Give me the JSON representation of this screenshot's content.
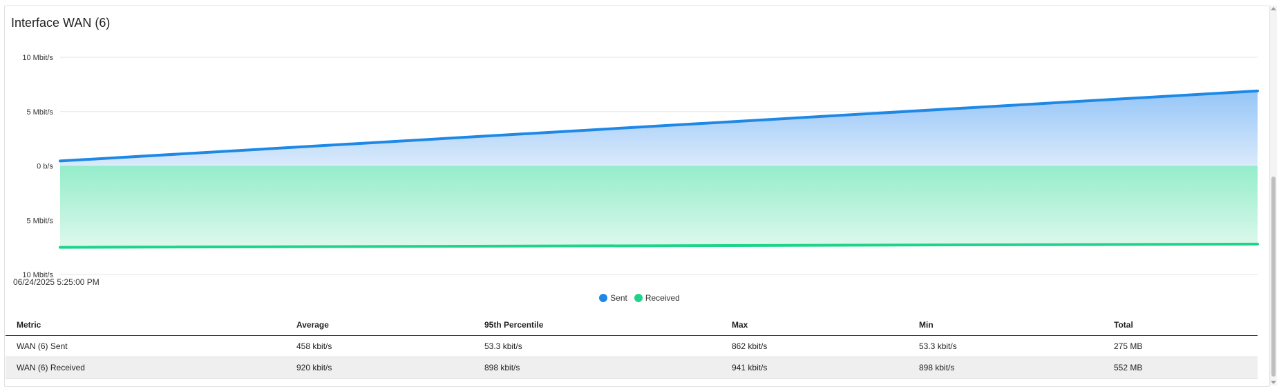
{
  "panel": {
    "title": "Interface WAN (6)",
    "timestamp": "06/24/2025 5:25:00 PM"
  },
  "chart_data": {
    "type": "area",
    "title": "Interface WAN (6)",
    "y_tick_labels": [
      "10 Mbit/s",
      "5 Mbit/s",
      "0 b/s",
      "5 Mbit/s",
      "10 Mbit/s"
    ],
    "y_tick_values": [
      10,
      5,
      0,
      -5,
      -10
    ],
    "ylim": [
      -10,
      10
    ],
    "y_unit": "Mbit/s",
    "grid": true,
    "legend_position": "bottom-center",
    "x": [
      "06/24/2025 5:25:00 PM",
      ""
    ],
    "series": [
      {
        "name": "Sent",
        "color": "#1e88e5",
        "values": [
          0.45,
          6.9
        ]
      },
      {
        "name": "Received",
        "color": "#1ed48a",
        "values": [
          -7.5,
          -7.2
        ]
      }
    ]
  },
  "legend": [
    {
      "label": "Sent",
      "color": "#1e88e5"
    },
    {
      "label": "Received",
      "color": "#1ed48a"
    }
  ],
  "table": {
    "headers": [
      "Metric",
      "Average",
      "95th Percentile",
      "Max",
      "Min",
      "Total"
    ],
    "rows": [
      [
        "WAN (6) Sent",
        "458 kbit/s",
        "53.3 kbit/s",
        "862 kbit/s",
        "53.3 kbit/s",
        "275 MB"
      ],
      [
        "WAN (6) Received",
        "920 kbit/s",
        "898 kbit/s",
        "941 kbit/s",
        "898 kbit/s",
        "552 MB"
      ]
    ]
  }
}
